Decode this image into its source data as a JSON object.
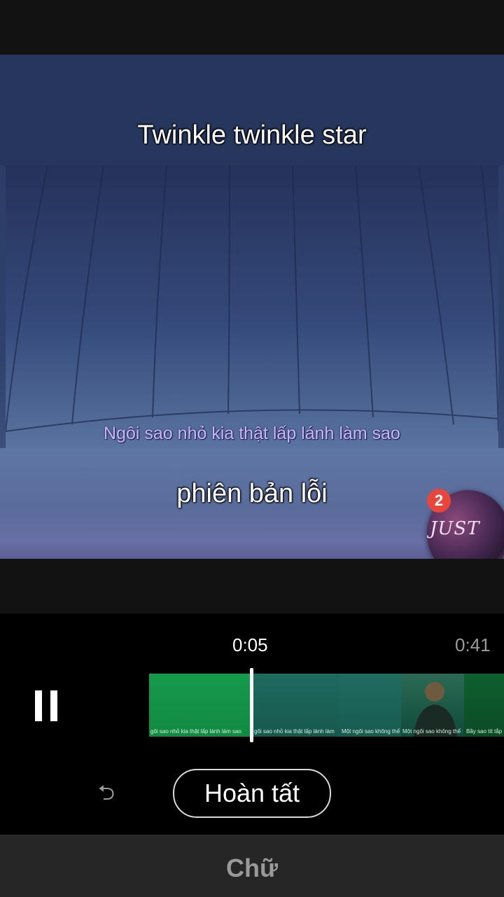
{
  "video": {
    "caption_top": "Twinkle twinkle star",
    "caption_sub": "Ngôi sao nhỏ kia thật lấp lánh làm sao",
    "caption_bottom": "phiên bản lỗi"
  },
  "chat_bubble": {
    "badge_count": "2",
    "thumbnail_text": "JUST"
  },
  "timeline": {
    "current_time": "0:05",
    "total_time": "0:41",
    "playhead_fraction": 0.12,
    "segment_captions": [
      "gôi sao nhỏ kia thật lấp lánh làm sao",
      "gôi sao nhỏ kia thật lấp lánh làm",
      "Một ngôi sao không thể kiên",
      "Một ngôi sao không thể kiên",
      "Bầy sao tít tắp"
    ]
  },
  "controls": {
    "pause_icon": "pause-icon",
    "undo_icon": "undo-icon",
    "done_label": "Hoàn tất"
  },
  "bottom_tab": {
    "label": "Chữ"
  },
  "colors": {
    "accent_green": "#0c5c3a",
    "badge_red": "#e8453c"
  }
}
